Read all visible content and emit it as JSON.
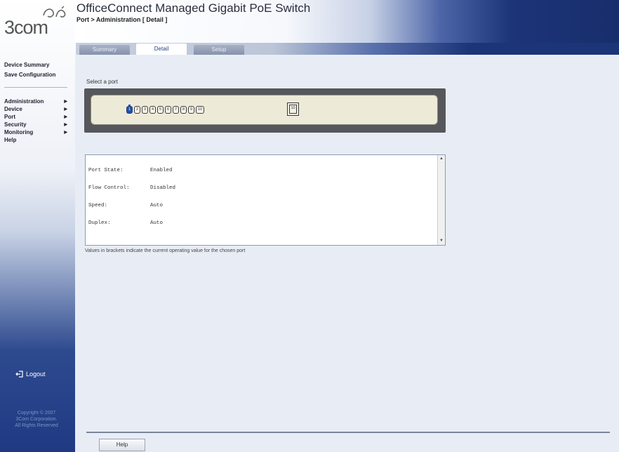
{
  "brand": {
    "logo_text": "3com"
  },
  "header": {
    "title": "OfficeConnect Managed Gigabit PoE Switch",
    "breadcrumb": "Port > Administration [ Detail ]"
  },
  "tabs": [
    {
      "label": "Summary"
    },
    {
      "label": "Detail"
    },
    {
      "label": "Setup"
    }
  ],
  "sidebar": {
    "device_summary": "Device Summary",
    "save_configuration": "Save Configuration",
    "menu": [
      {
        "label": "Administration"
      },
      {
        "label": "Device"
      },
      {
        "label": "Port"
      },
      {
        "label": "Security"
      },
      {
        "label": "Monitoring"
      },
      {
        "label": "Help"
      }
    ],
    "logout": "Logout",
    "copyright": [
      "Copyright © 2007",
      "3Com Corporation.",
      "All Rights Reserved"
    ]
  },
  "main": {
    "select_port_label": "Select a port",
    "ports": [
      "1",
      "2",
      "3",
      "4",
      "5",
      "6",
      "7",
      "8",
      "9",
      "10"
    ],
    "selected_port": "1",
    "uplink_port": "10",
    "details": [
      {
        "label": "Port State:",
        "value": "Enabled"
      },
      {
        "label": "Flow Control:",
        "value": "Disabled"
      },
      {
        "label": "Speed:",
        "value": "Auto"
      },
      {
        "label": "Duplex:",
        "value": "Auto"
      }
    ],
    "note": "Values in brackets indicate the current operating value for the chosen port",
    "help_button": "Help"
  }
}
